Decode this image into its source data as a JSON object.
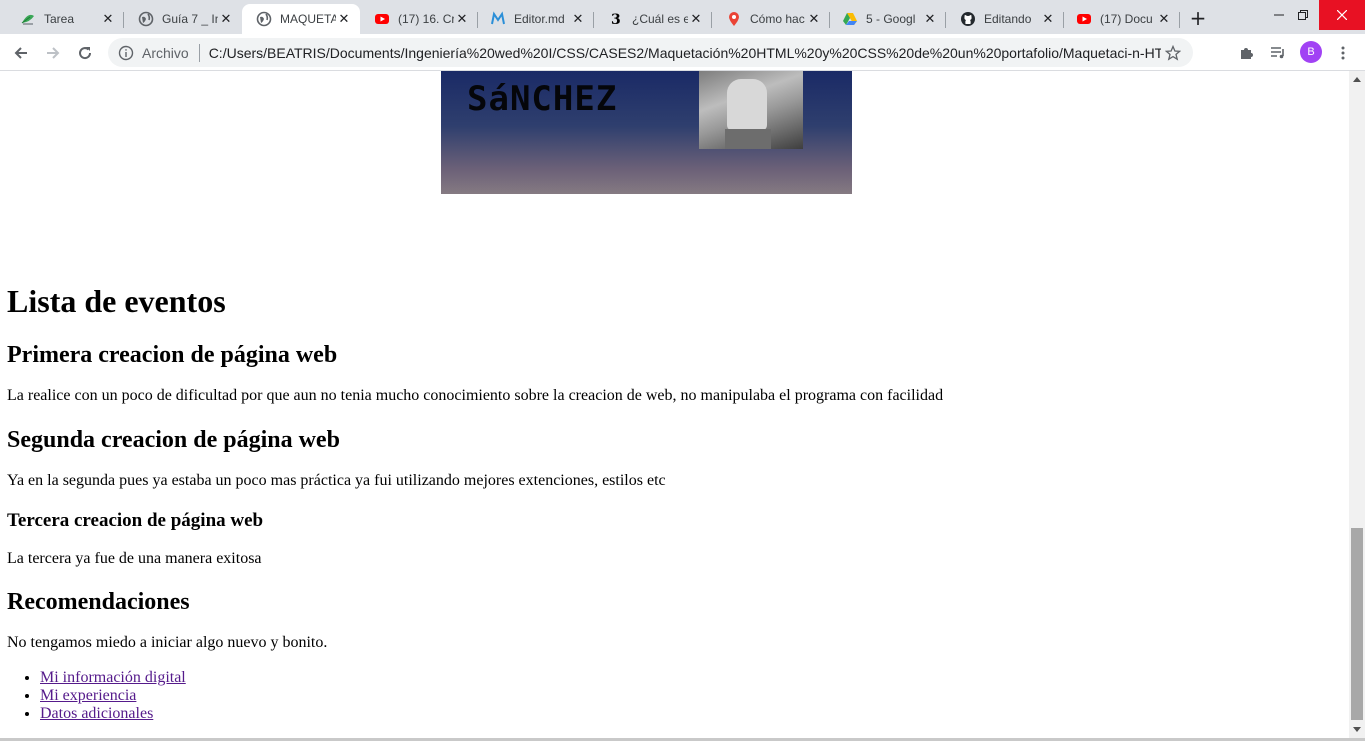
{
  "browser": {
    "tabs": [
      {
        "title": "Tarea",
        "icon": "green-leaf-icon"
      },
      {
        "title": "Guía 7 _ In",
        "icon": "globe-icon"
      },
      {
        "title": "MAQUETA",
        "icon": "globe-icon"
      },
      {
        "title": "(17) 16. Cr",
        "icon": "youtube-icon"
      },
      {
        "title": "Editor.md",
        "icon": "editor-md-icon"
      },
      {
        "title": "¿Cuál es e",
        "icon": "brainly-icon"
      },
      {
        "title": "Cómo hac",
        "icon": "maps-pin-icon"
      },
      {
        "title": "5 - Googl",
        "icon": "google-drive-icon"
      },
      {
        "title": "Editando",
        "icon": "github-icon"
      },
      {
        "title": "(17) Docu",
        "icon": "youtube-icon"
      }
    ],
    "active_tab_index": 2,
    "address_scheme_label": "Archivo",
    "url": "C:/Users/BEATRIS/Documents/Ingeniería%20wed%20I/CSS/CASES2/Maquetación%20HTML%20y%20CSS%20de%20un%20portafolio/Maquetaci-n-HT...",
    "profile_initial": "B"
  },
  "page": {
    "banner_name": "SáNCHEZ",
    "heading": "Lista de eventos",
    "section1_title": "Primera creacion de página web",
    "section1_text": "La realice con un poco de dificultad por que aun no tenia mucho conocimiento sobre la creacion de web, no manipulaba el programa con facilidad",
    "section2_title": "Segunda creacion de página web",
    "section2_text": "Ya en la segunda pues ya estaba un poco mas práctica ya fui utilizando mejores extenciones, estilos etc",
    "section3_title": "Tercera creacion de página web",
    "section3_text": "La tercera ya fue de una manera exitosa",
    "recommendations_title": "Recomendaciones",
    "recommendations_text": "No tengamos miedo a iniciar algo nuevo y bonito.",
    "links": [
      "Mi información digital",
      "Mi experiencia",
      "Datos adicionales"
    ]
  }
}
